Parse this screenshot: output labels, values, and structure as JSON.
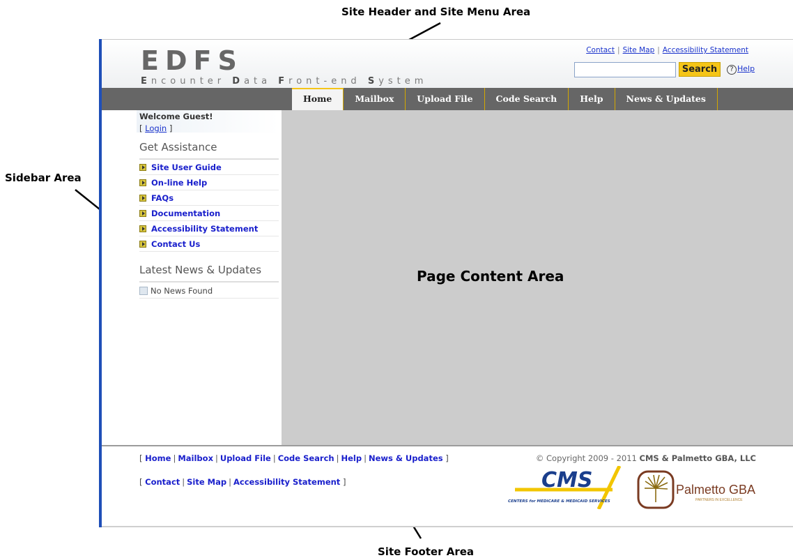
{
  "callouts": {
    "header": "Site Header and Site Menu Area",
    "sidebar": "Sidebar Area",
    "content": "Page Content Area",
    "footer": "Site Footer Area"
  },
  "header": {
    "logo": "EDFS",
    "tagline_parts": [
      "E",
      "ncounter ",
      "D",
      "ata ",
      "F",
      "ront-end ",
      "S",
      "ystem"
    ],
    "top_links": [
      "Contact",
      "Site Map",
      "Accessibility Statement"
    ],
    "search_placeholder": "",
    "search_button": "Search",
    "help_icon": "?",
    "help_label": "Help"
  },
  "menu": {
    "items": [
      "Home",
      "Mailbox",
      "Upload File",
      "Code Search",
      "Help",
      "News & Updates"
    ],
    "active": "Home"
  },
  "sidebar": {
    "welcome": "Welcome Guest!",
    "login_open": "[",
    "login_label": "Login",
    "login_close": "]",
    "assistance_heading": "Get Assistance",
    "assistance_items": [
      "Site User Guide",
      "On-line Help",
      "FAQs",
      "Documentation",
      "Accessibility Statement",
      "Contact Us"
    ],
    "news_heading": "Latest News & Updates",
    "news_empty": "No News Found"
  },
  "footer": {
    "open": "[",
    "close": "]",
    "row1": [
      "Home",
      "Mailbox",
      "Upload File",
      "Code Search",
      "Help",
      "News & Updates"
    ],
    "row2": [
      "Contact",
      "Site Map",
      "Accessibility Statement"
    ],
    "copyright_prefix": "© Copyright 2009 - 2011",
    "copyright_owner": "CMS & Palmetto GBA, LLC",
    "cms_logo_text": "CMS",
    "cms_logo_sub": "CENTERS for MEDICARE & MEDICAID SERVICES",
    "pgba_logo_text": "Palmetto GBA",
    "pgba_logo_sub": "PARTNERS IN EXCELLENCE"
  },
  "colors": {
    "accent_blue": "#1f4fb8",
    "menu_bg": "#666666",
    "search_button": "#f5c518",
    "content_bg": "#cccccc"
  }
}
